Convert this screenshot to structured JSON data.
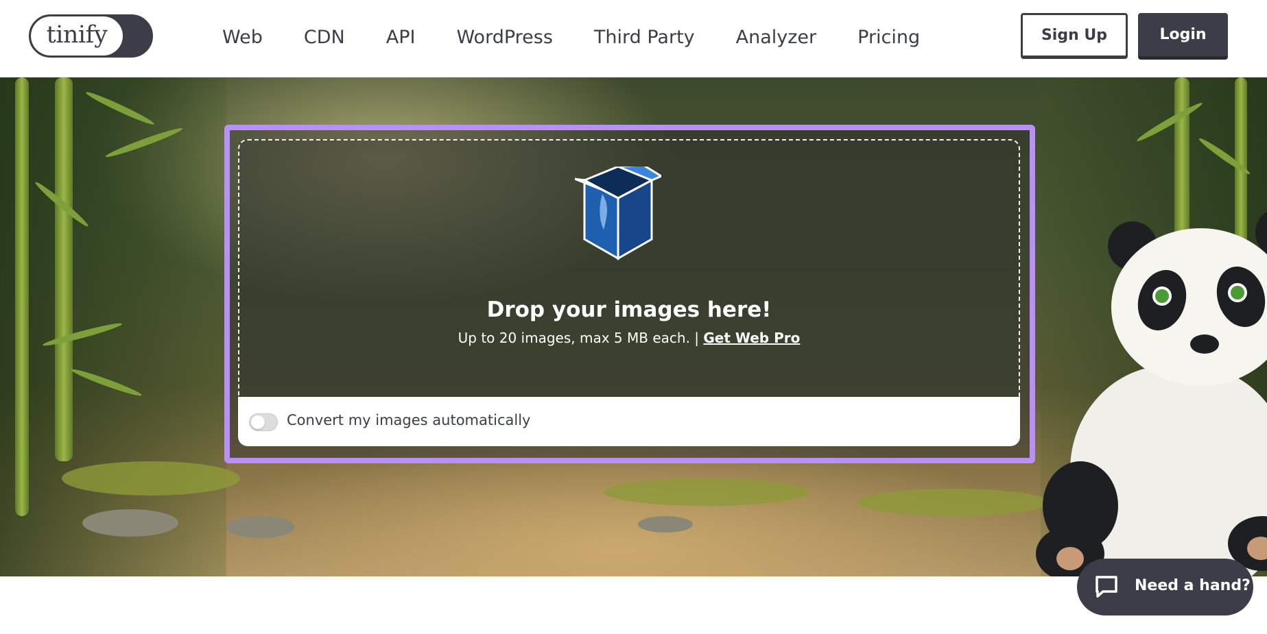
{
  "header": {
    "logo_text": "tinify",
    "nav": [
      "Web",
      "CDN",
      "API",
      "WordPress",
      "Third Party",
      "Analyzer",
      "Pricing"
    ],
    "signup_label": "Sign Up",
    "login_label": "Login"
  },
  "dropzone": {
    "title": "Drop your images here!",
    "subtitle": "Up to 20 images, max 5 MB each. |",
    "link_label": "Get Web Pro",
    "convert_label": "Convert my images automatically",
    "convert_enabled": false,
    "frame_color": "#b990f7"
  },
  "help": {
    "label": "Need a hand?"
  },
  "colors": {
    "brand_dark": "#3b3e49",
    "accent_purple": "#b990f7"
  },
  "icons": {
    "drop": "open-box-icon",
    "help": "chat-bubble-icon"
  }
}
